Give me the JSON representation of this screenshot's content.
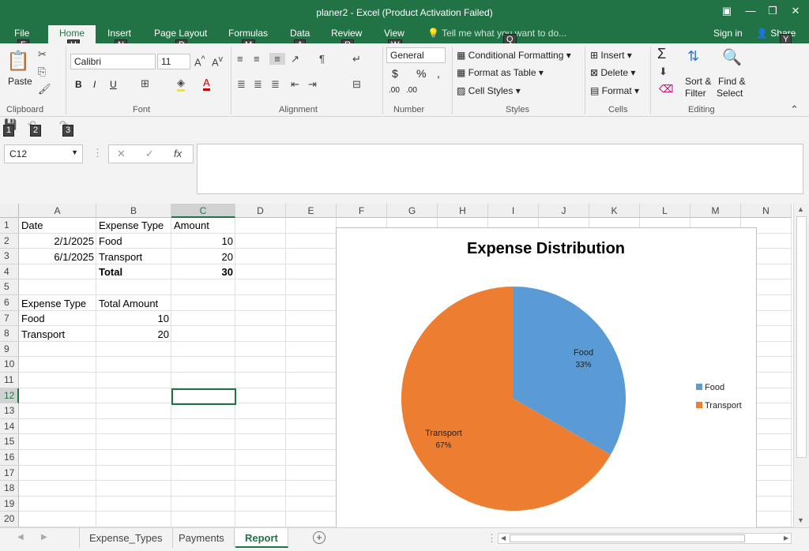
{
  "window": {
    "title": "planer2 - Excel (Product Activation Failed)"
  },
  "ribbon_tabs": [
    {
      "label": "File",
      "key": "F"
    },
    {
      "label": "Home",
      "key": "H"
    },
    {
      "label": "Insert",
      "key": "N"
    },
    {
      "label": "Page Layout",
      "key": "P"
    },
    {
      "label": "Formulas",
      "key": "M"
    },
    {
      "label": "Data",
      "key": "A"
    },
    {
      "label": "Review",
      "key": "R"
    },
    {
      "label": "View",
      "key": "W"
    }
  ],
  "tell_me": {
    "placeholder": "Tell me what you want to do...",
    "key": "Q"
  },
  "account": {
    "signin": "Sign in",
    "share": "Share",
    "share_key": "Y"
  },
  "clipboard": {
    "paste": "Paste",
    "label": "Clipboard"
  },
  "font": {
    "name": "Calibri",
    "size": "11",
    "label": "Font",
    "bold": "B",
    "italic": "I",
    "underline": "U"
  },
  "alignment": {
    "label": "Alignment"
  },
  "number": {
    "format": "General",
    "label": "Number",
    "currency": "$",
    "percent": "%",
    "comma": ",",
    "inc_dec": ".00",
    "dec_dec": ".00"
  },
  "styles": {
    "conditional": "Conditional Formatting",
    "format_table": "Format as Table",
    "cell_styles": "Cell Styles",
    "label": "Styles"
  },
  "cells": {
    "insert": "Insert",
    "delete": "Delete",
    "format": "Format",
    "label": "Cells"
  },
  "editing": {
    "sort": "Sort &",
    "sort2": "Filter",
    "find": "Find &",
    "find2": "Select",
    "label": "Editing",
    "sigma": "Σ"
  },
  "qat_keys": [
    "1",
    "2",
    "3"
  ],
  "namebox": "C12",
  "fx": "fx",
  "columns": [
    "A",
    "B",
    "C",
    "D",
    "E",
    "F",
    "G",
    "H",
    "I",
    "J",
    "K",
    "L",
    "M",
    "N"
  ],
  "rows": [
    "1",
    "2",
    "3",
    "4",
    "5",
    "6",
    "7",
    "8",
    "9",
    "10",
    "11",
    "12",
    "13",
    "14",
    "15",
    "16",
    "17",
    "18",
    "19",
    "20"
  ],
  "cells_data": {
    "A1": "Date",
    "B1": "Expense Type",
    "C1": "Amount",
    "A2": "2/1/2025",
    "B2": "Food",
    "C2": "10",
    "A3": "6/1/2025",
    "B3": "Transport",
    "C3": "20",
    "B4": "Total",
    "C4": "30",
    "A6": "Expense Type",
    "B6": "Total Amount",
    "A7": "Food",
    "B7": "10",
    "A8": "Transport",
    "B8": "20"
  },
  "chart_data": {
    "type": "pie",
    "title": "Expense Distribution",
    "categories": [
      "Food",
      "Transport"
    ],
    "values": [
      10,
      20
    ],
    "percent_labels": [
      "33%",
      "67%"
    ],
    "colors": [
      "#5b9bd5",
      "#ed7d31"
    ],
    "legend": "right"
  },
  "sheets": [
    {
      "label": "Expense_Types",
      "active": false
    },
    {
      "label": "Payments",
      "active": false
    },
    {
      "label": "Report",
      "active": true
    }
  ]
}
